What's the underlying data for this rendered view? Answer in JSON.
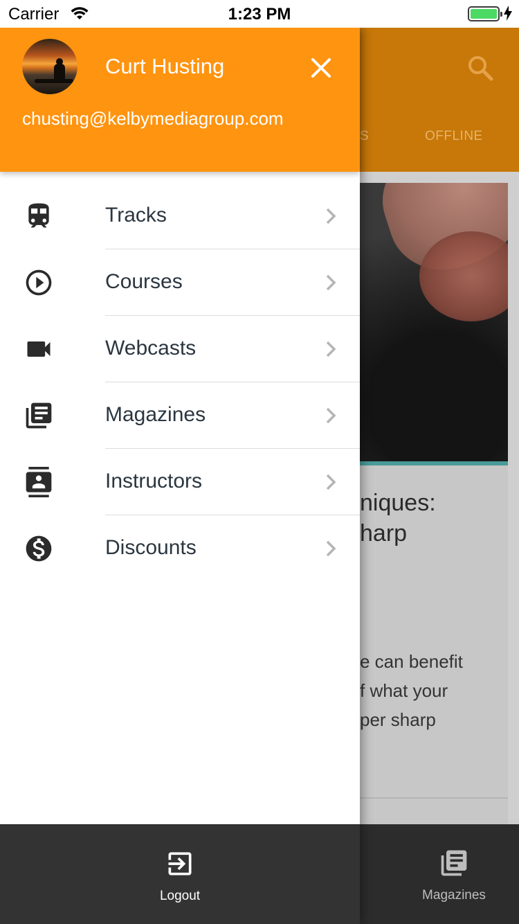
{
  "status_bar": {
    "carrier": "Carrier",
    "time": "1:23 PM",
    "battery_color": "#4cd964"
  },
  "background": {
    "header_color": "#c77808",
    "tab_partial": "S",
    "tab_offline": "OFFLINE",
    "card_title_lines": [
      "niques:",
      "harp"
    ],
    "card_desc_lines": [
      "e can benefit",
      "f what your",
      "per sharp"
    ],
    "bottom_nav_label": "Magazines"
  },
  "drawer": {
    "header_color": "#ff9410",
    "user": {
      "name": "Curt Husting",
      "email": "chusting@kelbymediagroup.com"
    },
    "menu": [
      {
        "label": "Tracks",
        "icon": "train-icon"
      },
      {
        "label": "Courses",
        "icon": "play-circle-icon"
      },
      {
        "label": "Webcasts",
        "icon": "videocam-icon"
      },
      {
        "label": "Magazines",
        "icon": "library-books-icon"
      },
      {
        "label": "Instructors",
        "icon": "contact-card-icon"
      },
      {
        "label": "Discounts",
        "icon": "dollar-circle-icon"
      }
    ],
    "logout_label": "Logout"
  }
}
